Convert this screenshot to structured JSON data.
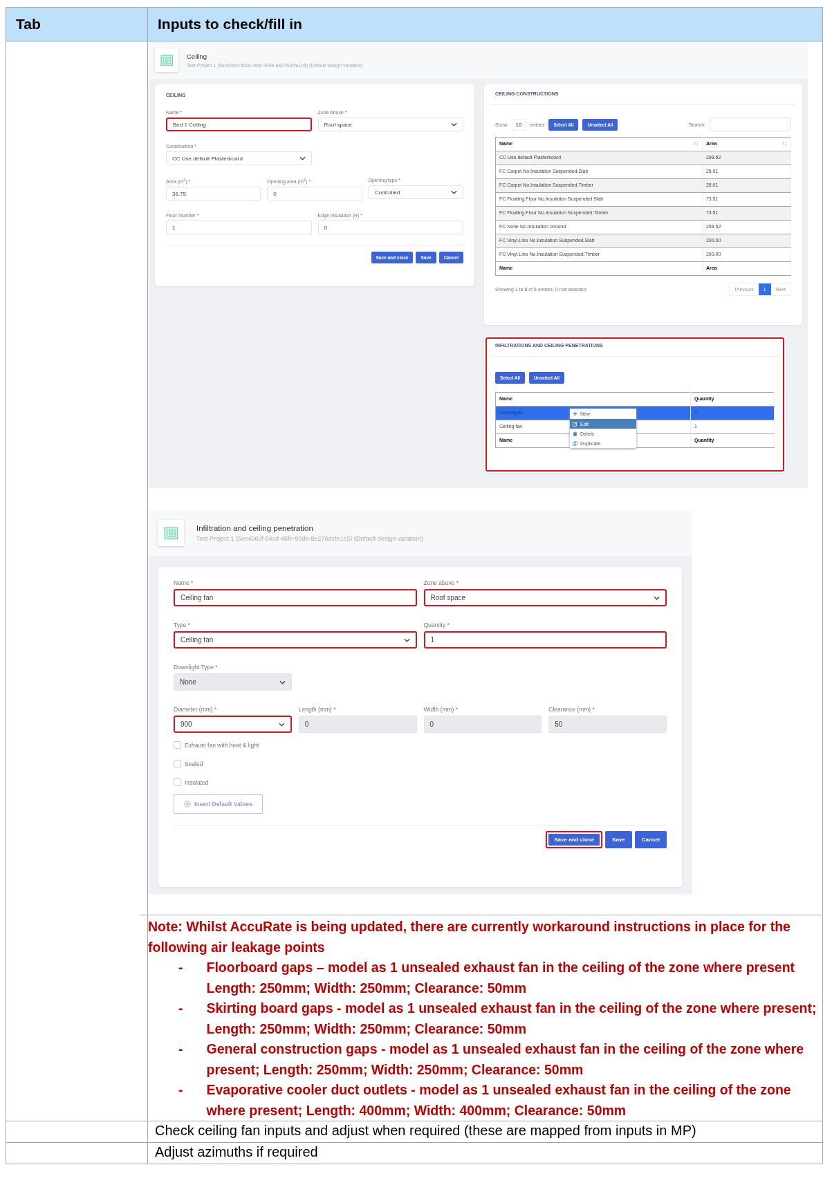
{
  "table": {
    "columns": [
      "Tab",
      "Inputs to check/fill in"
    ]
  },
  "ceiling_screen": {
    "header": {
      "title": "Ceiling",
      "subtitle": "Test Project 1 (5ec406cf-54cd-46fe-90de-8e276dcfe1c5) (Default design variation)"
    },
    "form": {
      "section_title": "CEILING",
      "form_lines": [
        {
          "fields": [
            {
              "label": "Name *",
              "value": "Bed 1 Ceiling",
              "kind": "text",
              "highlighted": true,
              "disabled": false
            },
            {
              "label": "Zone Above *",
              "value": "Roof space",
              "kind": "select",
              "highlighted": false,
              "disabled": false
            }
          ]
        },
        {
          "fields": [
            {
              "label": "Construction *",
              "value": "CC Use.default Plasterboard",
              "kind": "select",
              "highlighted": false,
              "disabled": false
            }
          ]
        },
        {
          "fields": [
            {
              "label": "Area (m$^{2}$) *",
              "value": "36.75",
              "kind": "text",
              "highlighted": false,
              "disabled": false
            },
            {
              "label": "Opening area (m$^{2}$) *",
              "value": "0",
              "kind": "text",
              "highlighted": false,
              "disabled": false
            },
            {
              "label": "Opening type *",
              "value": "Controlled",
              "kind": "select",
              "highlighted": false,
              "disabled": false
            }
          ]
        },
        {
          "fields": [
            {
              "label": "Floor Number *",
              "value": "1",
              "kind": "text",
              "highlighted": false,
              "disabled": false
            },
            {
              "label": "Edge Insulation (R) *",
              "value": "0",
              "kind": "text",
              "highlighted": false,
              "disabled": false
            }
          ]
        }
      ],
      "buttons": [
        {
          "label": "Save and close",
          "highlighted": false
        },
        {
          "label": "Save",
          "highlighted": false
        },
        {
          "label": "Cancel",
          "highlighted": false
        }
      ]
    },
    "constructions": {
      "title": "CEILING CONSTRUCTIONS",
      "show_label": "Show",
      "entries_value": "10",
      "entries_label": "entries",
      "buttons": [
        "Select All",
        "Unselect All"
      ],
      "search_label": "Search:",
      "columns": [
        "Name",
        "Area"
      ],
      "rows": [
        [
          "CC Use.default Plasterboard",
          "298.52"
        ],
        [
          "FC Carpet No.Insulation Suspended.Slab",
          "25.01"
        ],
        [
          "FC Carpet No.Insulation Suspended.Timber",
          "25.01"
        ],
        [
          "FC Floating.Floor No.Insulation Suspended.Slab",
          "73.51"
        ],
        [
          "FC Floating.Floor No.Insulation Suspended.Timber",
          "73.51"
        ],
        [
          "FC None No.Insulation Ground",
          "298.52"
        ],
        [
          "FC Vinyl.Lino No.Insulation Suspended.Slab",
          "200.00"
        ],
        [
          "FC Vinyl.Lino No.Insulation Suspended.Timber",
          "200.00"
        ]
      ],
      "footer_columns": [
        "Name",
        "Area"
      ],
      "info": "Showing 1 to 8 of 8 entries, 0 row selected",
      "pagination": [
        {
          "label": "Previous",
          "selected": false
        },
        {
          "label": "1",
          "selected": true
        },
        {
          "label": "Next",
          "selected": false
        }
      ]
    },
    "penetrations": {
      "title": "INFILTRATIONS AND CEILING PENETRATIONS",
      "highlighted": true,
      "buttons": [
        "Select All",
        "Unselect All"
      ],
      "columns": [
        "Name",
        "Quantity"
      ],
      "rows": [
        {
          "name": "Downlights",
          "quantity": "4",
          "selected": true
        },
        {
          "name": "Ceiling fan",
          "quantity": "1",
          "selected": false
        }
      ],
      "footer_columns": [
        "Name",
        "Quantity"
      ],
      "context_menu": [
        {
          "label": "New",
          "selected": false
        },
        {
          "label": "Edit",
          "selected": true
        },
        {
          "label": "Delete",
          "selected": false
        },
        {
          "label": "Duplicate",
          "selected": false
        }
      ]
    }
  },
  "penetration_screen": {
    "header": {
      "title": "Infiltration and ceiling penetration",
      "subtitle": "Test Project 1 (5ec406cf-54cd-46fe-90de-8e276dcfe1c5) (Default design variation)"
    },
    "form_lines": [
      {
        "fields": [
          {
            "label": "Name *",
            "value": "Ceiling fan",
            "kind": "text",
            "highlighted": true,
            "disabled": false
          },
          {
            "label": "Zone above *",
            "value": "Roof space",
            "kind": "select",
            "highlighted": true,
            "disabled": false
          }
        ]
      },
      {
        "fields": [
          {
            "label": "Type *",
            "value": "Ceiling fan",
            "kind": "select",
            "highlighted": true,
            "disabled": false
          },
          {
            "label": "Quantity *",
            "value": "1",
            "kind": "text",
            "highlighted": true,
            "disabled": false
          }
        ]
      },
      {
        "fields": [
          {
            "label": "Downlight Type *",
            "value": "None",
            "kind": "select",
            "highlighted": false,
            "disabled": true
          }
        ]
      },
      {
        "fields": [
          {
            "label": "Diameter (mm) *",
            "value": "900",
            "kind": "select",
            "highlighted": true,
            "disabled": false
          },
          {
            "label": "Length (mm) *",
            "value": "0",
            "kind": "text",
            "highlighted": false,
            "disabled": true
          },
          {
            "label": "Width (mm) *",
            "value": "0",
            "kind": "text",
            "highlighted": false,
            "disabled": true
          },
          {
            "label": "Clearance (mm) *",
            "value": "50",
            "kind": "text",
            "highlighted": false,
            "disabled": true
          }
        ]
      }
    ],
    "checkboxes": [
      {
        "label": "Exhaust fan with heat & light",
        "checked": false
      },
      {
        "label": "Sealed",
        "checked": false
      },
      {
        "label": "Insulated",
        "checked": false
      }
    ],
    "insert_button": "Insert Default Values",
    "buttons": [
      {
        "label": "Save and close",
        "highlighted": true
      },
      {
        "label": "Save",
        "highlighted": false
      },
      {
        "label": "Cancel",
        "highlighted": false
      }
    ]
  },
  "note": {
    "heading": "Note: Whilst AccuRate is being updated, there are currently workaround instructions in place for the following air leakage points",
    "items": [
      "Floorboard gaps – model as 1 unsealed exhaust fan in the ceiling of the zone where present Length: 250mm; Width: 250mm; Clearance: 50mm",
      "Skirting board gaps - model as 1 unsealed exhaust fan in the ceiling of the zone where present; Length: 250mm; Width: 250mm; Clearance: 50mm",
      "General construction gaps - model as 1 unsealed exhaust fan in the ceiling of the zone where present; Length: 250mm; Width: 250mm; Clearance: 50mm",
      "Evaporative cooler duct outlets - model as 1 unsealed exhaust fan in the ceiling of the zone where present; Length: 400mm; Width: 400mm; Clearance: 50mm"
    ],
    "bullet": "-"
  },
  "rows": [
    {
      "text": "Check ceiling fan inputs and adjust when required (these are mapped from inputs in MP)"
    },
    {
      "text": "Adjust azimuths if required"
    }
  ]
}
